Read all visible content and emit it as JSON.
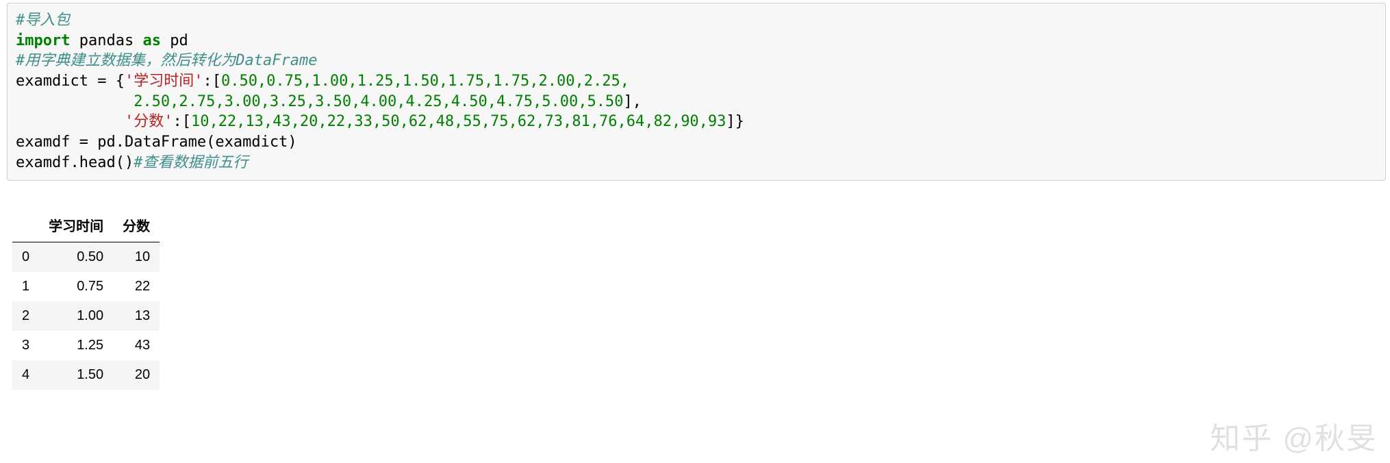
{
  "code": {
    "line1_comment": "#导入包",
    "line2_import": "import",
    "line2_pandas": " pandas ",
    "line2_as": "as",
    "line2_pd": " pd",
    "line3_comment": "#用字典建立数据集，然后转化为DataFrame",
    "line4_prefix": "examdict = {",
    "line4_key1": "'学习时间'",
    "line4_after_key1": ":[",
    "line4_nums": "0.50,0.75,1.00,1.25,1.50,1.75,1.75,2.00,2.25,",
    "line5_indent": "             ",
    "line5_nums": "2.50,2.75,3.00,3.25,3.50,4.00,4.25,4.50,4.75,5.00,5.50",
    "line5_close": "],",
    "line6_indent": "            ",
    "line6_key2": "'分数'",
    "line6_after_key2": ":[",
    "line6_nums": "10,22,13,43,20,22,33,50,62,48,55,75,62,73,81,76,64,82,90,93",
    "line6_close": "]}",
    "line7": "examdf = pd.DataFrame(examdict)",
    "line8_code": "examdf.head()",
    "line8_comment": "#查看数据前五行"
  },
  "table": {
    "columns": [
      "学习时间",
      "分数"
    ],
    "index": [
      "0",
      "1",
      "2",
      "3",
      "4"
    ],
    "rows": [
      [
        "0.50",
        "10"
      ],
      [
        "0.75",
        "22"
      ],
      [
        "1.00",
        "13"
      ],
      [
        "1.25",
        "43"
      ],
      [
        "1.50",
        "20"
      ]
    ]
  },
  "watermark": "知乎 @秋旻"
}
